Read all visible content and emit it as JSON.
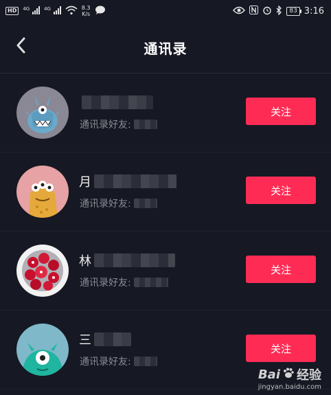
{
  "status_bar": {
    "hd": "HD",
    "net1": "4G",
    "net2": "4G",
    "speed_value": "8.3",
    "speed_unit": "K/s",
    "battery": "83",
    "time": "3:16"
  },
  "nav": {
    "title": "通讯录"
  },
  "contacts": [
    {
      "name_prefix": "",
      "sub_label": "通讯录好友:",
      "button_label": "关注",
      "avatar": "blue-monster-avatar"
    },
    {
      "name_prefix": "月",
      "sub_label": "通讯录好友:",
      "button_label": "关注",
      "avatar": "orange-monster-avatar"
    },
    {
      "name_prefix": "林",
      "sub_label": "通讯录好友:",
      "button_label": "关注",
      "avatar": "red-flower-avatar"
    },
    {
      "name_prefix": "三",
      "sub_label": "通讯录好友:",
      "button_label": "关注",
      "avatar": "teal-monster-avatar"
    }
  ],
  "watermark": {
    "brand_letters": "Bai",
    "brand_text": "经验",
    "url": "jingyan.baidu.com"
  },
  "colors": {
    "background": "#161823",
    "accent": "#fe2c55"
  }
}
